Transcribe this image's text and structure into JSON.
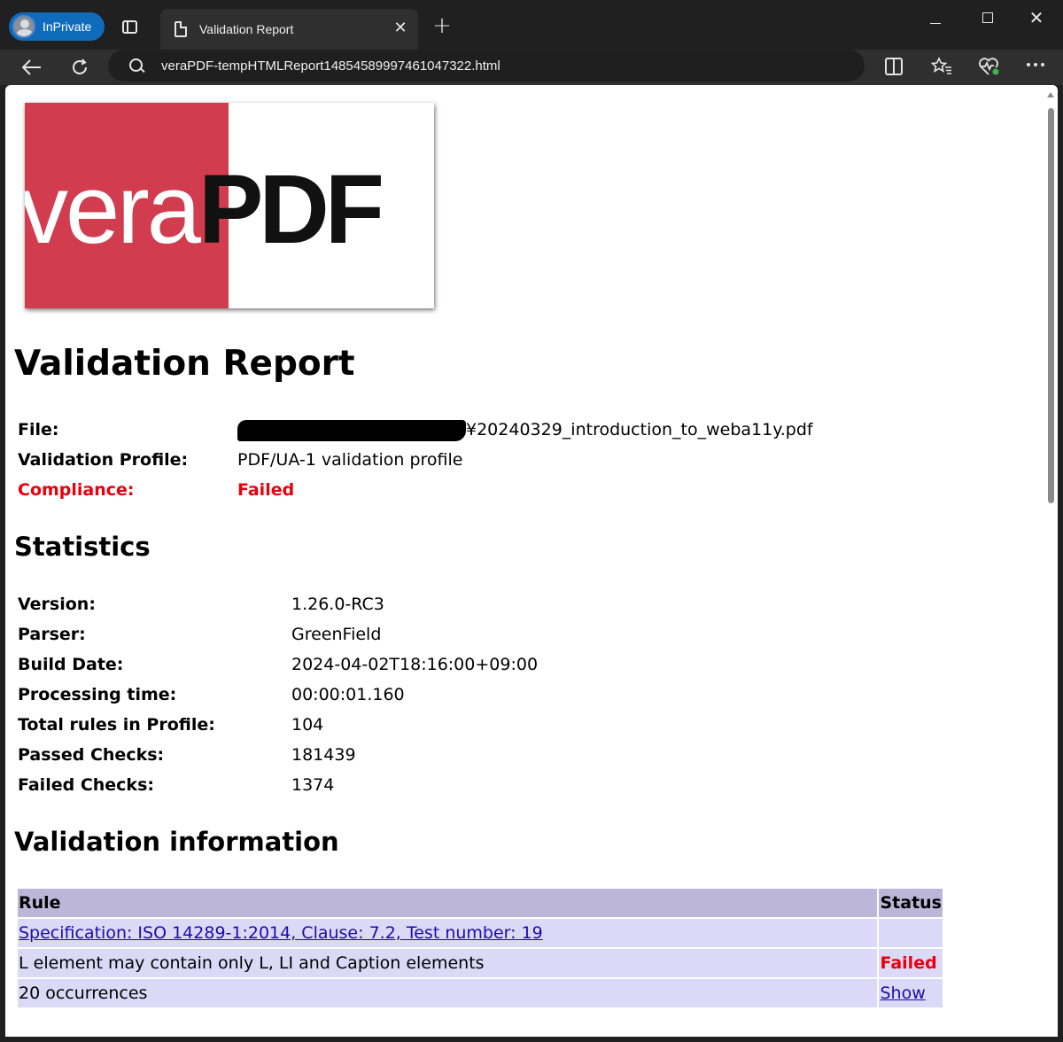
{
  "browser": {
    "profile_label": "InPrivate",
    "tab_title": "Validation Report",
    "tab_close": "✕",
    "new_tab": "+",
    "url": "veraPDF-tempHTMLReport14854589997461047322.html",
    "window_close": "✕"
  },
  "logo": {
    "part1": "vera",
    "part2": "PDF"
  },
  "report": {
    "title": "Validation Report",
    "file_label": "File:",
    "file_value": "¥20240329_introduction_to_weba11y.pdf",
    "profile_label": "Validation Profile:",
    "profile_value": "PDF/UA-1 validation profile",
    "compliance_label": "Compliance:",
    "compliance_value": "Failed"
  },
  "statistics": {
    "title": "Statistics",
    "rows": [
      {
        "label": "Version:",
        "value": "1.26.0-RC3"
      },
      {
        "label": "Parser:",
        "value": "GreenField"
      },
      {
        "label": "Build Date:",
        "value": "2024-04-02T18:16:00+09:00"
      },
      {
        "label": "Processing time:",
        "value": "00:00:01.160"
      },
      {
        "label": "Total rules in Profile:",
        "value": "104"
      },
      {
        "label": "Passed Checks:",
        "value": "181439"
      },
      {
        "label": "Failed Checks:",
        "value": "1374"
      }
    ]
  },
  "validation": {
    "title": "Validation information",
    "header_rule": "Rule",
    "header_status": "Status",
    "spec_link": "Specification: ISO 14289-1:2014, Clause: 7.2, Test number: 19",
    "rule_description": "L element may contain only L, LI and Caption elements",
    "rule_status": "Failed",
    "occurrences": "20 occurrences",
    "show_link": "Show"
  },
  "colors": {
    "logo_red": "#d13d4e",
    "failed_red": "#e8000d",
    "table_header": "#bcb7d9",
    "table_row": "#dcd9f6",
    "link_blue": "#1a0dab"
  }
}
